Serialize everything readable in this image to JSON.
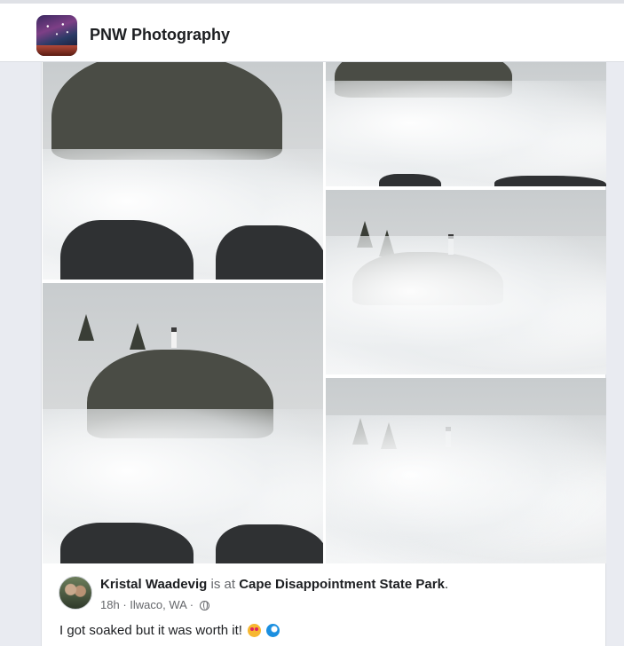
{
  "header": {
    "group_name": "PNW Photography",
    "group_avatar_icon": "group-avatar-milky-way"
  },
  "post": {
    "photos": [
      {
        "name": "wave-crashing-on-sea-stack"
      },
      {
        "name": "spray-over-rocks"
      },
      {
        "name": "lighthouse-behind-spray"
      },
      {
        "name": "lighthouse-cliff-wave"
      },
      {
        "name": "lighthouse-in-mist"
      }
    ],
    "author": "Kristal Waadevig",
    "is_at": "is at",
    "location": "Cape Disappointment State Park",
    "period": ".",
    "time": "18h",
    "dot": "·",
    "place": "Ilwaco, WA",
    "dot2": "·",
    "privacy_icon": "globe-icon",
    "caption": "I got soaked but it was worth it!",
    "emojis": [
      "heart-eyes-emoji",
      "wave-emoji"
    ]
  },
  "colors": {
    "text": "#1c1e21",
    "muted": "#65676b",
    "background": "#e9ebf1"
  }
}
